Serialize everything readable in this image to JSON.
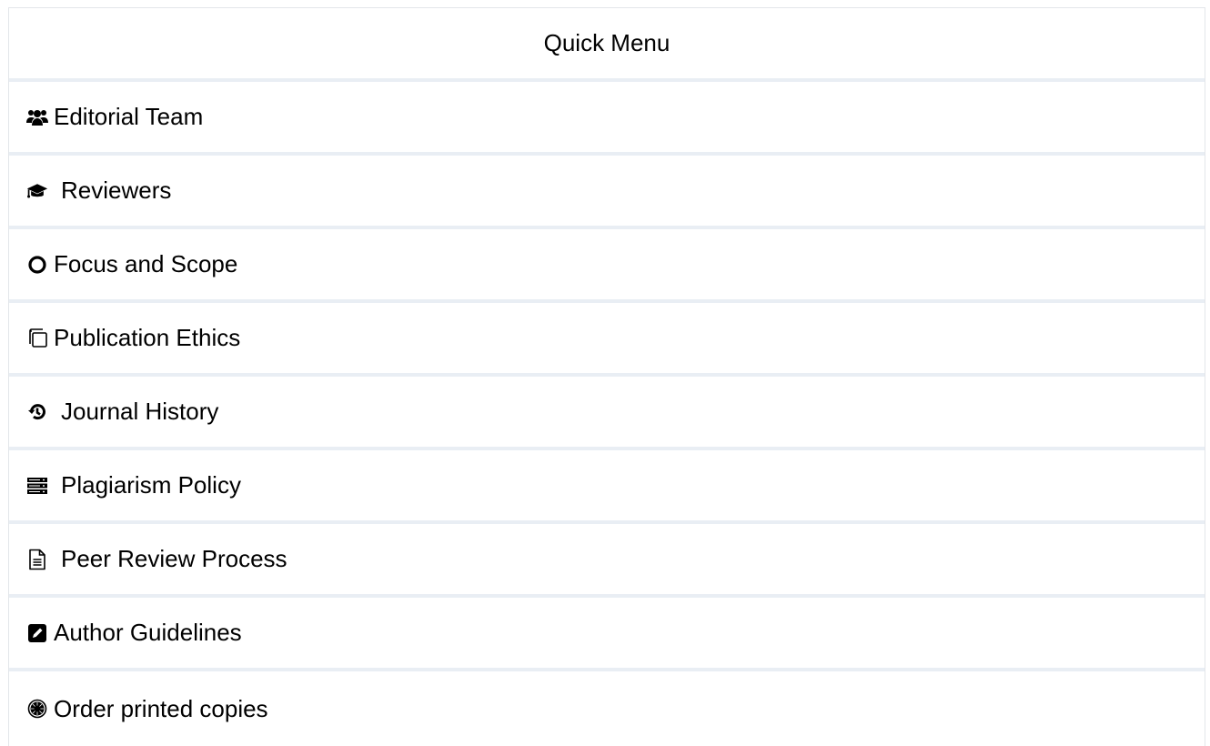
{
  "menu": {
    "title": "Quick Menu",
    "items": [
      {
        "label": "Editorial Team",
        "icon": "users-icon"
      },
      {
        "label": "Reviewers",
        "icon": "graduation-cap-icon"
      },
      {
        "label": "Focus and Scope",
        "icon": "circle-icon"
      },
      {
        "label": "Publication Ethics",
        "icon": "copy-icon"
      },
      {
        "label": "Journal History",
        "icon": "history-icon"
      },
      {
        "label": "Plagiarism Policy",
        "icon": "server-icon"
      },
      {
        "label": "Peer Review Process",
        "icon": "document-icon"
      },
      {
        "label": "Author Guidelines",
        "icon": "edit-icon"
      },
      {
        "label": "Order printed copies",
        "icon": "seal-icon"
      }
    ]
  }
}
